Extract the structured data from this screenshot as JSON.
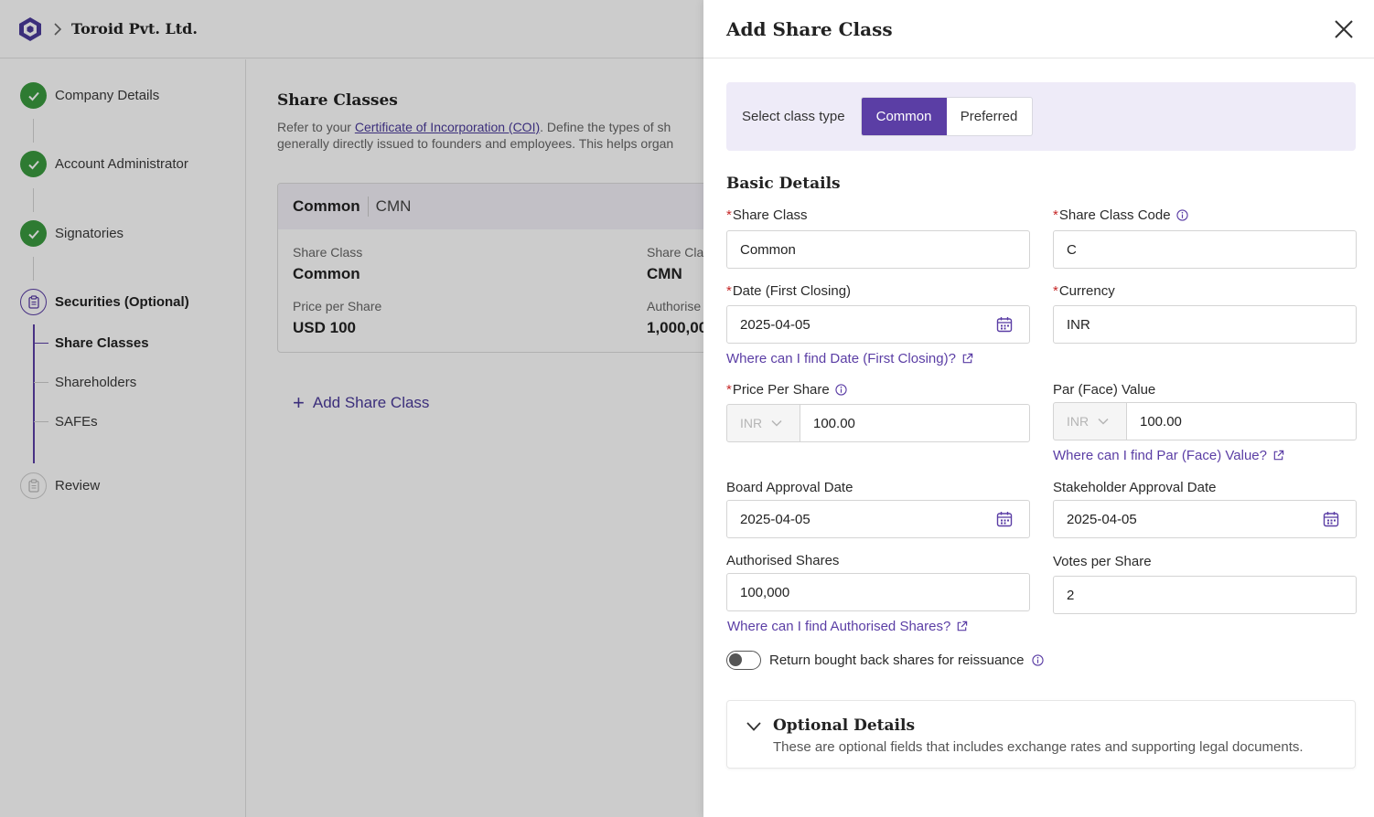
{
  "header": {
    "company": "Toroid Pvt. Ltd."
  },
  "sidebar": {
    "steps": [
      {
        "label": "Company Details",
        "status": "done"
      },
      {
        "label": "Account Administrator",
        "status": "done"
      },
      {
        "label": "Signatories",
        "status": "done"
      },
      {
        "label": "Securities (Optional)",
        "status": "active"
      },
      {
        "label": "Review",
        "status": "todo"
      }
    ],
    "substeps": [
      {
        "label": "Share Classes",
        "active": true
      },
      {
        "label": "Shareholders",
        "active": false
      },
      {
        "label": "SAFEs",
        "active": false
      }
    ]
  },
  "main": {
    "title": "Share Classes",
    "desc_prefix": "Refer to your ",
    "desc_link": "Certificate of Incorporation (COI)",
    "desc_suffix": ". Define the types of sh",
    "desc_line2": "generally directly issued to founders and employees. This helps organ",
    "card": {
      "name": "Common",
      "code": "CMN",
      "share_class_label": "Share Class",
      "share_class_value": "Common",
      "code_label": "Share Cla",
      "code_value": "CMN",
      "price_label": "Price per Share",
      "price_value": "USD 100",
      "auth_label": "Authorise",
      "auth_value": "1,000,00"
    },
    "add_label": "Add Share Class"
  },
  "drawer": {
    "title": "Add Share Class",
    "class_type_label": "Select class type",
    "class_types": [
      "Common",
      "Preferred"
    ],
    "selected_type": "Common",
    "section": "Basic Details",
    "fields": {
      "share_class": {
        "label": "Share Class",
        "value": "Common"
      },
      "share_class_code": {
        "label": "Share Class Code",
        "value": "C"
      },
      "date_first_closing": {
        "label": "Date (First Closing)",
        "value": "2025-04-05"
      },
      "currency": {
        "label": "Currency",
        "value": "INR"
      },
      "price_per_share": {
        "label": "Price Per Share",
        "currency": "INR",
        "value": "100.00"
      },
      "par_value": {
        "label": "Par (Face) Value",
        "currency": "INR",
        "value": "100.00"
      },
      "board_approval_date": {
        "label": "Board Approval Date",
        "value": "2025-04-05"
      },
      "stakeholder_approval_date": {
        "label": "Stakeholder Approval Date",
        "value": "2025-04-05"
      },
      "authorised_shares": {
        "label": "Authorised Shares",
        "value": "100,000"
      },
      "votes_per_share": {
        "label": "Votes per Share",
        "value": "2"
      }
    },
    "help": {
      "date_first_closing": "Where can I find Date (First Closing)?",
      "par_value": "Where can I find Par (Face) Value?",
      "authorised_shares": "Where can I find Authorised Shares?"
    },
    "toggle": {
      "label": "Return bought back shares for reissuance",
      "on": false
    },
    "optional": {
      "title": "Optional Details",
      "desc": "These are optional fields that includes exchange rates and supporting legal documents."
    },
    "required_mark": "*"
  },
  "colors": {
    "accent": "#5b3ea5",
    "success": "#3a9a3f",
    "required": "#c62828",
    "tint": "#eeebf8"
  }
}
